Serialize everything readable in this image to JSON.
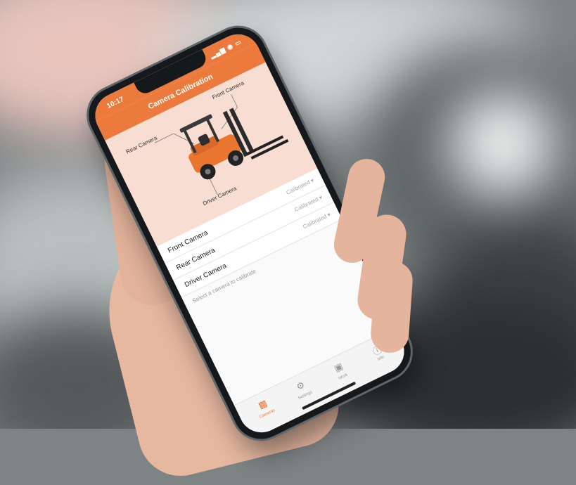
{
  "status_bar": {
    "time": "10:17",
    "icons": "▂▄▆ ◉ ▭"
  },
  "nav": {
    "title": "Camera Calibration"
  },
  "diagram": {
    "labels": {
      "rear": "Rear Camera",
      "front": "Front Camera",
      "driver": "Driver Camera"
    }
  },
  "camera_list": {
    "items": [
      {
        "name": "Front Camera",
        "status": "Calibrated ▾"
      },
      {
        "name": "Rear Camera",
        "status": "Calibrated ▾"
      },
      {
        "name": "Driver Camera",
        "status": "Calibrated ▾"
      }
    ],
    "hint": "Select a camera to calibrate"
  },
  "tab_bar": {
    "items": [
      {
        "label": "Cameras",
        "icon": "video-camera-icon"
      },
      {
        "label": "Settings",
        "icon": "gear-icon"
      },
      {
        "label": "Work",
        "icon": "briefcase-icon"
      },
      {
        "label": "Info",
        "icon": "info-icon"
      }
    ]
  },
  "colors": {
    "accent": "#ec7a3c",
    "diagram_bg": "#f7ddd2"
  }
}
